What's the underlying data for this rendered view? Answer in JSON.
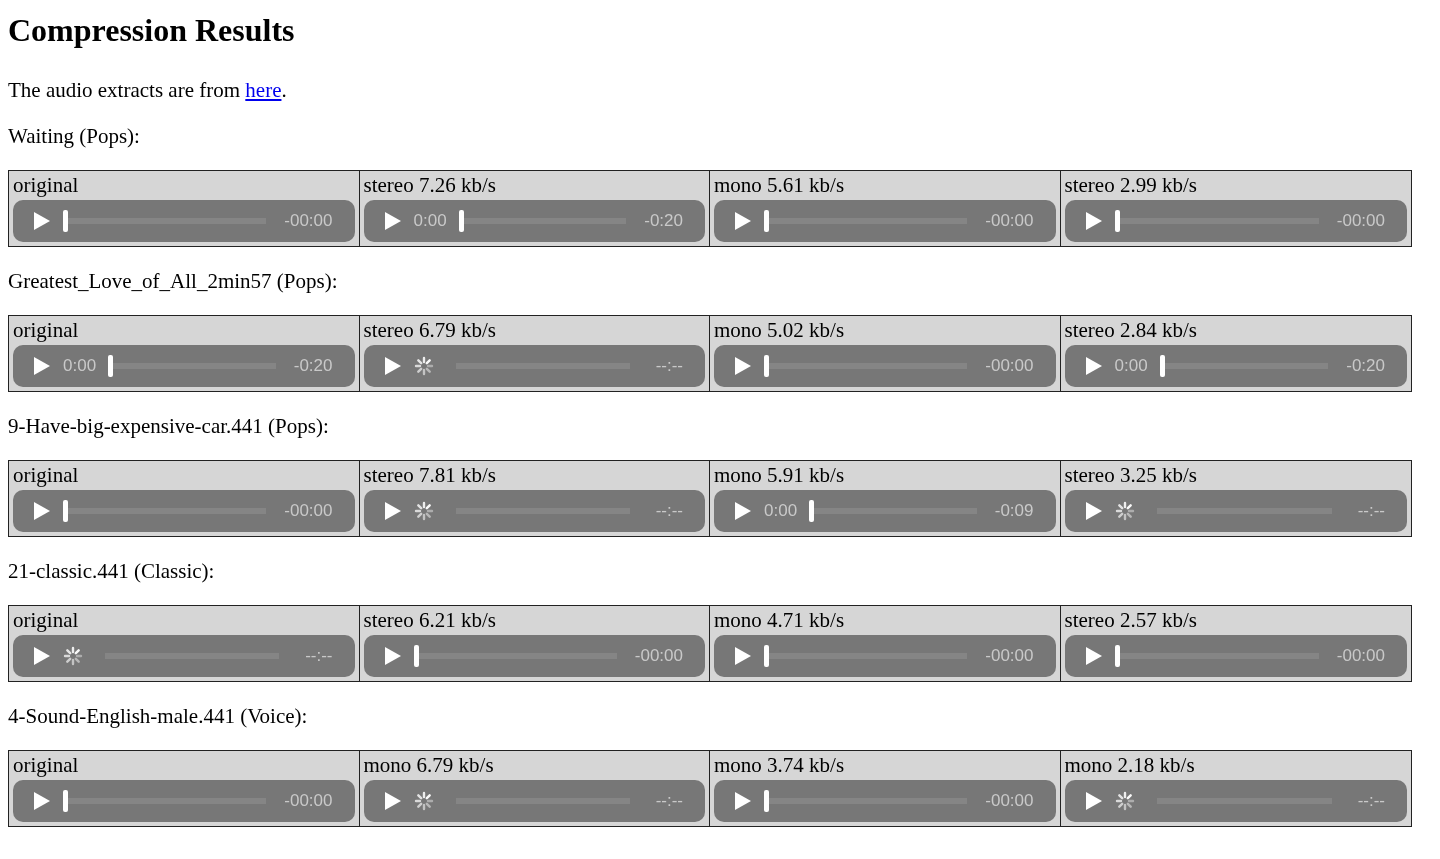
{
  "title": "Compression Results",
  "intro": {
    "before": "The audio extracts are from ",
    "link": "here",
    "after": "."
  },
  "sections": [
    {
      "label": "Waiting (Pops):",
      "players": [
        {
          "caption": "original",
          "kind": "idle",
          "remaining": "-00:00"
        },
        {
          "caption": "stereo 7.26 kb/s",
          "kind": "ready",
          "elapsed": "0:00",
          "remaining": "-0:20"
        },
        {
          "caption": "mono 5.61 kb/s",
          "kind": "idle",
          "remaining": "-00:00"
        },
        {
          "caption": "stereo 2.99 kb/s",
          "kind": "idle",
          "remaining": "-00:00"
        }
      ]
    },
    {
      "label": "Greatest_Love_of_All_2min57 (Pops):",
      "players": [
        {
          "caption": "original",
          "kind": "ready",
          "elapsed": "0:00",
          "remaining": "-0:20"
        },
        {
          "caption": "stereo 6.79 kb/s",
          "kind": "loading",
          "remaining": "--:--"
        },
        {
          "caption": "mono 5.02 kb/s",
          "kind": "idle",
          "remaining": "-00:00"
        },
        {
          "caption": "stereo 2.84 kb/s",
          "kind": "ready",
          "elapsed": "0:00",
          "remaining": "-0:20"
        }
      ]
    },
    {
      "label": "9-Have-big-expensive-car.441 (Pops):",
      "players": [
        {
          "caption": "original",
          "kind": "idle",
          "remaining": "-00:00"
        },
        {
          "caption": "stereo 7.81 kb/s",
          "kind": "loading",
          "remaining": "--:--"
        },
        {
          "caption": "mono 5.91 kb/s",
          "kind": "ready",
          "elapsed": "0:00",
          "remaining": "-0:09"
        },
        {
          "caption": "stereo 3.25 kb/s",
          "kind": "loading",
          "remaining": "--:--"
        }
      ]
    },
    {
      "label": "21-classic.441 (Classic):",
      "players": [
        {
          "caption": "original",
          "kind": "loading",
          "remaining": "--:--"
        },
        {
          "caption": "stereo 6.21 kb/s",
          "kind": "idle",
          "remaining": "-00:00"
        },
        {
          "caption": "mono 4.71 kb/s",
          "kind": "idle",
          "remaining": "-00:00"
        },
        {
          "caption": "stereo 2.57 kb/s",
          "kind": "idle",
          "remaining": "-00:00"
        }
      ]
    },
    {
      "label": "4-Sound-English-male.441 (Voice):",
      "players": [
        {
          "caption": "original",
          "kind": "idle",
          "remaining": "-00:00"
        },
        {
          "caption": "mono 6.79 kb/s",
          "kind": "loading",
          "remaining": "--:--"
        },
        {
          "caption": "mono 3.74 kb/s",
          "kind": "idle",
          "remaining": "-00:00"
        },
        {
          "caption": "mono 2.18 kb/s",
          "kind": "loading",
          "remaining": "--:--"
        }
      ]
    }
  ]
}
